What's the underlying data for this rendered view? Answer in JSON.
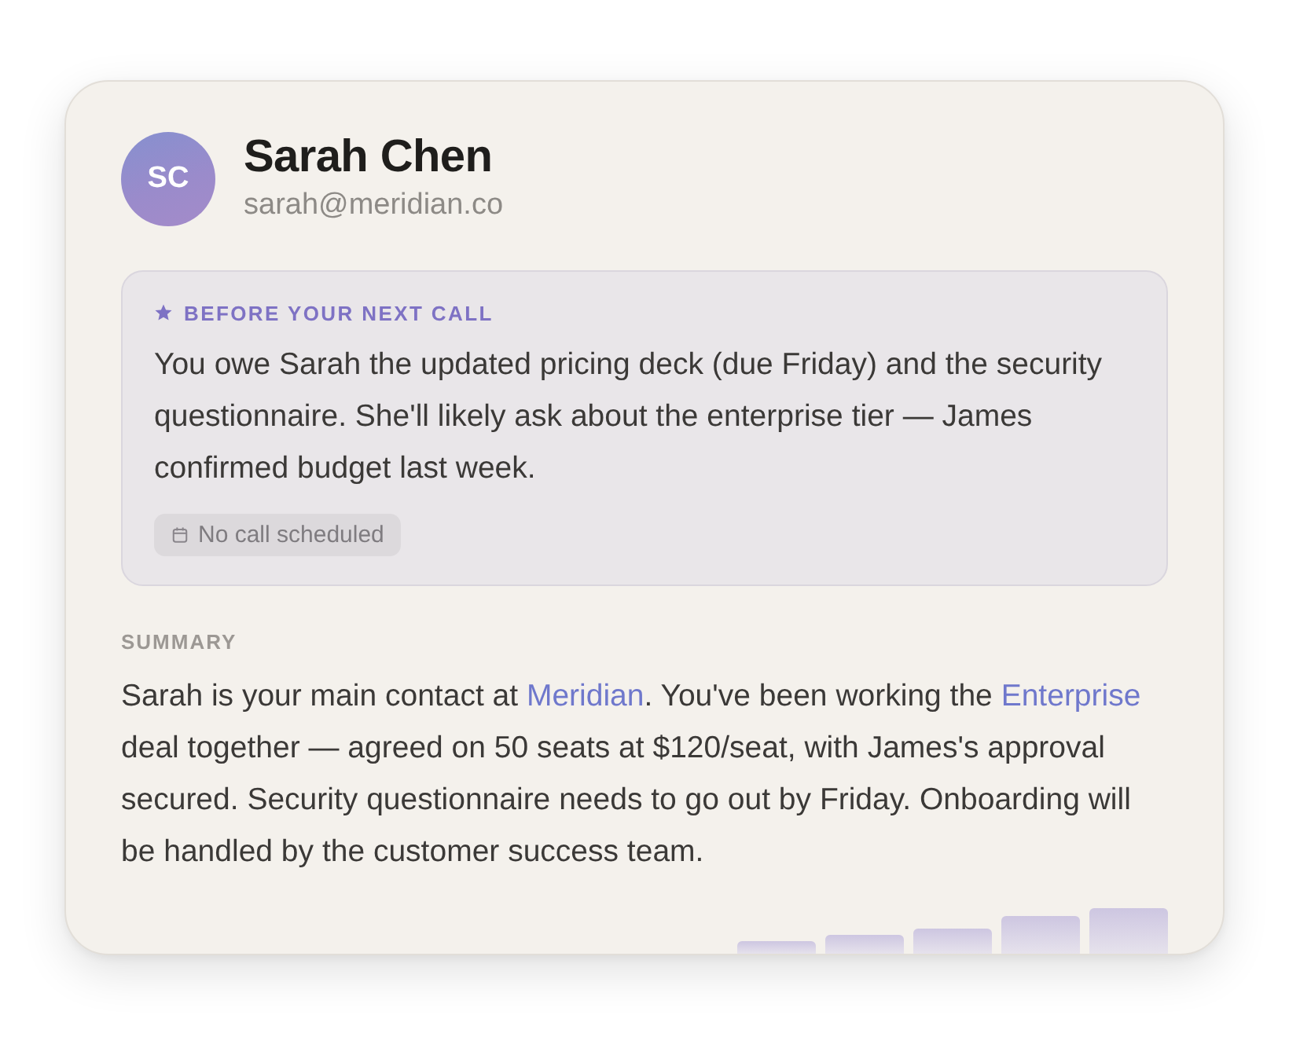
{
  "contact": {
    "initials": "SC",
    "name": "Sarah Chen",
    "email": "sarah@meridian.co"
  },
  "briefing": {
    "label": "BEFORE YOUR NEXT CALL",
    "text": "You owe Sarah the updated pricing deck (due Friday) and the security questionnaire. She'll likely ask about the enterprise tier — James confirmed budget last week.",
    "schedule": "No call scheduled"
  },
  "summary": {
    "label": "SUMMARY",
    "segments": [
      {
        "kind": "text",
        "text": "Sarah is your main contact at "
      },
      {
        "kind": "link",
        "text": "Meridian"
      },
      {
        "kind": "text",
        "text": ". You've been working the "
      },
      {
        "kind": "link",
        "text": "Enterprise"
      },
      {
        "kind": "text",
        "text": " deal together — agreed on 50 seats at $120/seat, with James's approval secured. Security questionnaire needs to go out by Friday. Onboarding will be handled by the customer success team."
      }
    ]
  }
}
